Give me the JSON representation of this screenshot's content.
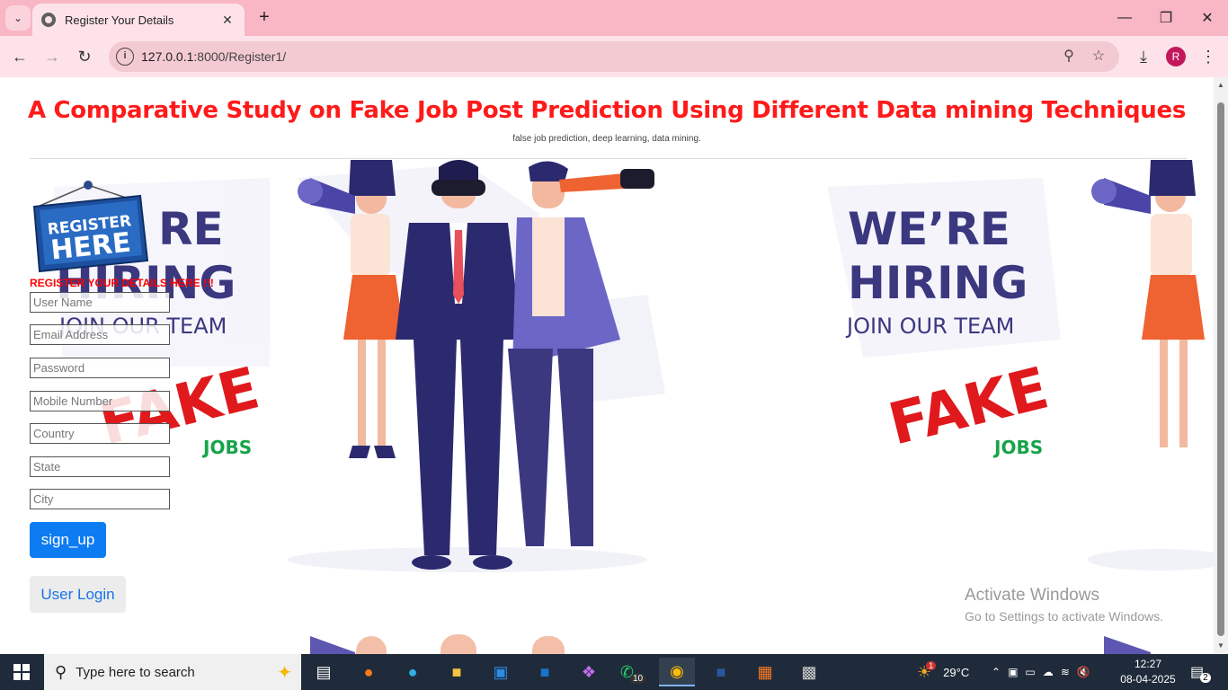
{
  "browser": {
    "tab_title": "Register Your Details",
    "url_host": "127.0.0.1",
    "url_path": ":8000/Register1/",
    "profile_initial": "R"
  },
  "page": {
    "title": "A Comparative Study on Fake Job Post Prediction Using Different Data mining Techniques",
    "subtitle": "false job prediction, deep learning, data mining."
  },
  "illustration": {
    "were": "WE’RE",
    "hiring": "HIRING",
    "join": "JOIN OUR TEAM",
    "fake": "FAKE",
    "jobs": "JOBS",
    "partial_re": "RE",
    "partial_hiring": "HIRING",
    "partial_join": "JOIN OUR TEAM",
    "badge_line1": "REGISTER",
    "badge_line2": "HERE"
  },
  "form": {
    "heading": "REGISTER YOUR DETAILS HERE !!!",
    "fields": {
      "username": "User Name",
      "email": "Email Address",
      "password": "Password",
      "mobile": "Mobile Number",
      "country": "Country",
      "state": "State",
      "city": "City"
    },
    "signup_label": "sign_up",
    "login_label": "User Login"
  },
  "watermark": {
    "title": "Activate Windows",
    "subtitle": "Go to Settings to activate Windows."
  },
  "taskbar": {
    "search_placeholder": "Type here to search",
    "whatsapp_badge": "10",
    "weather_temp": "29°C",
    "weather_badge": "1",
    "time": "12:27",
    "date": "08-04-2025",
    "notification_count": "2"
  },
  "colors": {
    "title_red": "#ff1a1a",
    "signup_blue": "#0d7cf2",
    "tabbar_pink": "#f9b6c4"
  }
}
